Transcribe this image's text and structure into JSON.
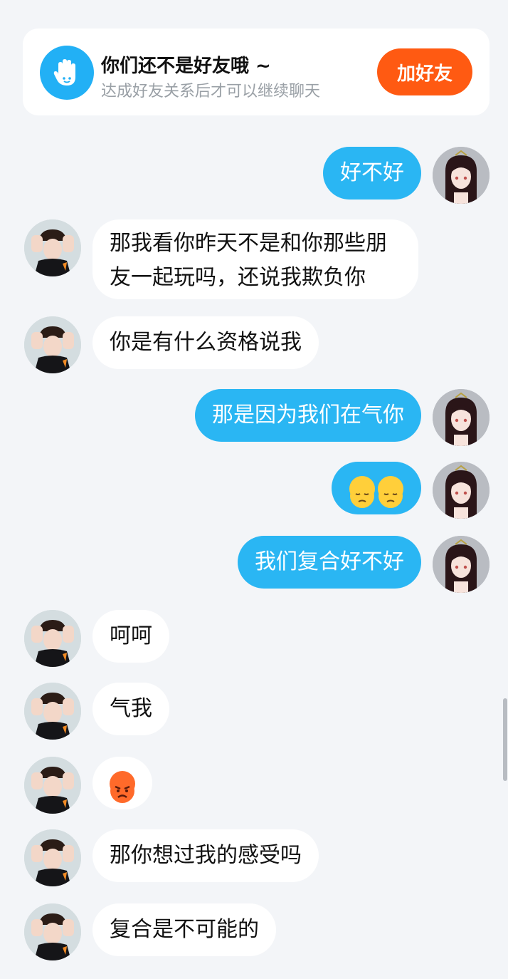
{
  "banner": {
    "title": "你们还不是好友哦 ~",
    "subtitle": "达成好友关系后才可以继续聊天",
    "add_button": "加好友",
    "icon": "hand-wave-icon"
  },
  "messages": [
    {
      "sender": "me",
      "text": "好不好"
    },
    {
      "sender": "them",
      "text": "那我看你昨天不是和你那些朋友一起玩吗，还说我欺负你"
    },
    {
      "sender": "them",
      "text": "你是有什么资格说我"
    },
    {
      "sender": "me",
      "text": "那是因为我们在气你"
    },
    {
      "sender": "me",
      "text": "😔😔",
      "emoji": "pensive-face"
    },
    {
      "sender": "me",
      "text": "我们复合好不好"
    },
    {
      "sender": "them",
      "text": "呵呵"
    },
    {
      "sender": "them",
      "text": "气我"
    },
    {
      "sender": "them",
      "text": "😡",
      "emoji": "angry-face"
    },
    {
      "sender": "them",
      "text": "那你想过我的感受吗"
    },
    {
      "sender": "them",
      "text": "复合是不可能的"
    }
  ],
  "colors": {
    "accent": "#2ab6f3",
    "add_button": "#ff5a12",
    "background": "#f3f5f8"
  }
}
